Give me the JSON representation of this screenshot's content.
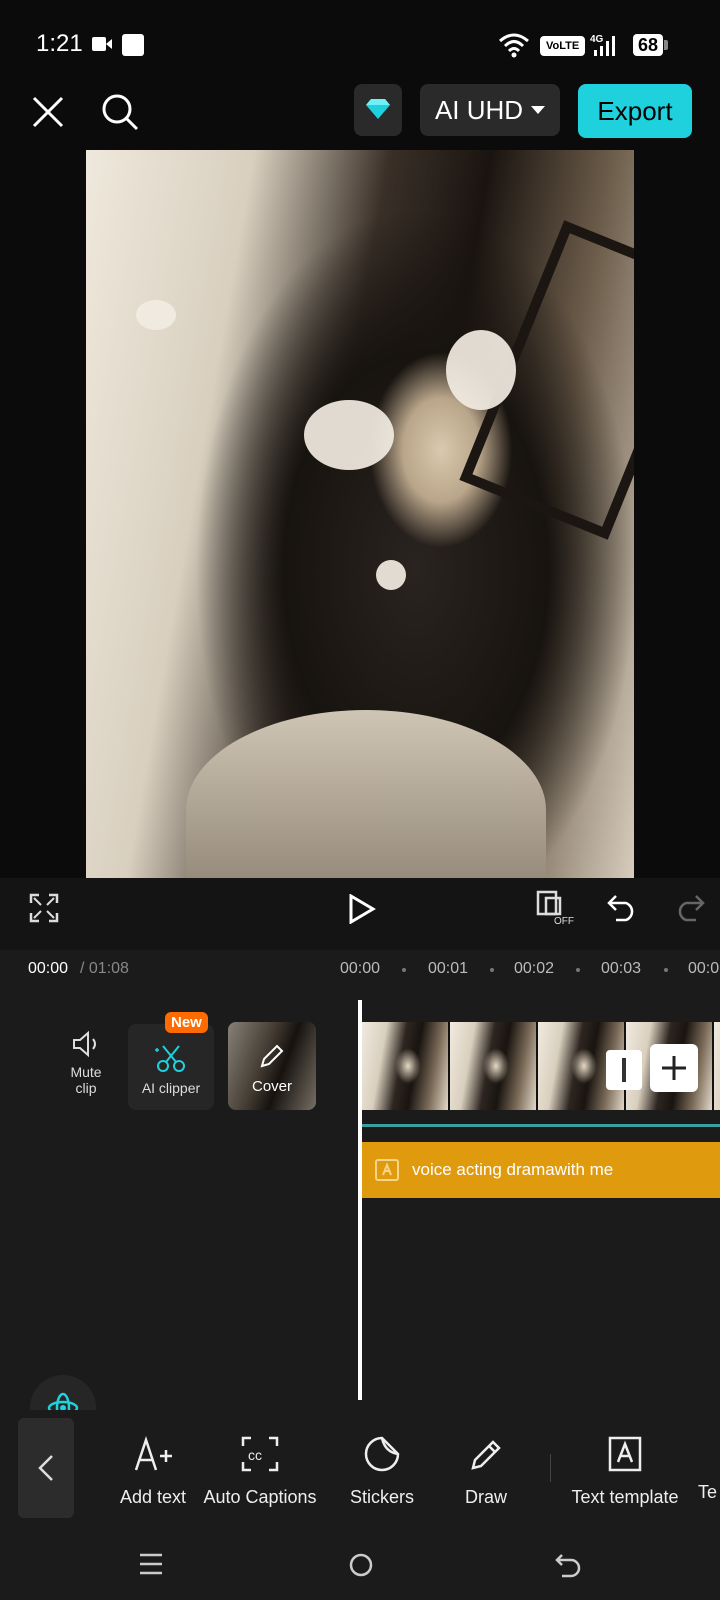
{
  "status_bar": {
    "time": "1:21",
    "network_badge": "VoLTE",
    "network_type": "4G",
    "battery": "68"
  },
  "top_bar": {
    "resolution_label": "AI UHD",
    "export_label": "Export",
    "accent": "#1ed1dc"
  },
  "controls": {
    "keyframe_state": "OFF"
  },
  "timeline": {
    "current_time": "00:00",
    "total_time": "/ 01:08",
    "ruler": [
      "00:00",
      "00:01",
      "00:02",
      "00:03",
      "00:0"
    ],
    "tools": {
      "mute_label": "Mute clip",
      "ai_clipper_label": "AI clipper",
      "new_badge": "New",
      "cover_label": "Cover"
    },
    "caption_text": "voice acting dramawith me",
    "caption_color": "#e09a0d"
  },
  "toolbar": {
    "items": [
      {
        "label": "Add text",
        "icon": "add-text-icon"
      },
      {
        "label": "Auto Captions",
        "icon": "captions-icon"
      },
      {
        "label": "Stickers",
        "icon": "sticker-icon"
      },
      {
        "label": "Draw",
        "icon": "pen-icon"
      },
      {
        "label": "Text template",
        "icon": "text-template-icon"
      },
      {
        "label": "Te",
        "icon": ""
      }
    ]
  }
}
